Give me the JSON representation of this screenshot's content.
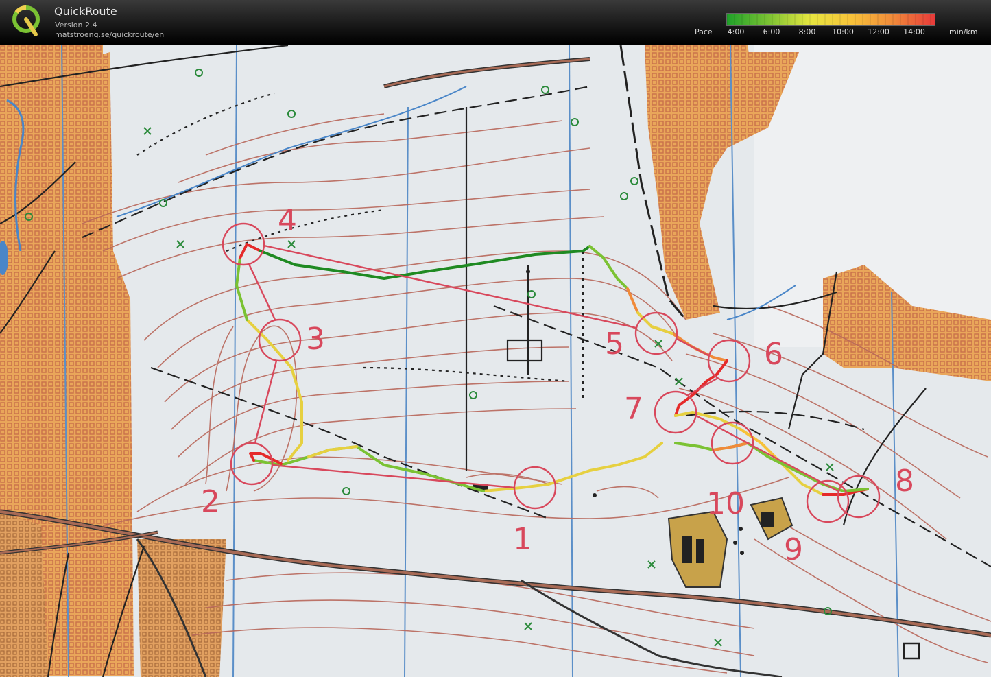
{
  "app": {
    "title": "QuickRoute",
    "version": "Version 2.4",
    "url": "matstroeng.se/quickroute/en",
    "logo_letter": "Q"
  },
  "legend": {
    "label": "Pace",
    "ticks": [
      "4:00",
      "6:00",
      "8:00",
      "10:00",
      "12:00",
      "14:00"
    ],
    "unit": "min/km",
    "colors": [
      "#1fa12a",
      "#7bc233",
      "#e6e640",
      "#f7c23a",
      "#f08a3a",
      "#e83a3a"
    ]
  },
  "map": {
    "colors": {
      "contour": "#b8675a",
      "orange_area": "#e7a14b",
      "grid_dot": "#c9704a",
      "magnetic_line": "#4a86c8",
      "track_red": "#e52a2a",
      "course": "#d8485c",
      "road": "#333333",
      "road_fill": "#a86a55"
    },
    "controls": [
      {
        "num": "1",
        "label": "1"
      },
      {
        "num": "2",
        "label": "2"
      },
      {
        "num": "3",
        "label": "3"
      },
      {
        "num": "4",
        "label": "4"
      },
      {
        "num": "5",
        "label": "5"
      },
      {
        "num": "6",
        "label": "6"
      },
      {
        "num": "7",
        "label": "7"
      },
      {
        "num": "8",
        "label": "8"
      },
      {
        "num": "9",
        "label": "9"
      },
      {
        "num": "10",
        "label": "10"
      }
    ]
  }
}
